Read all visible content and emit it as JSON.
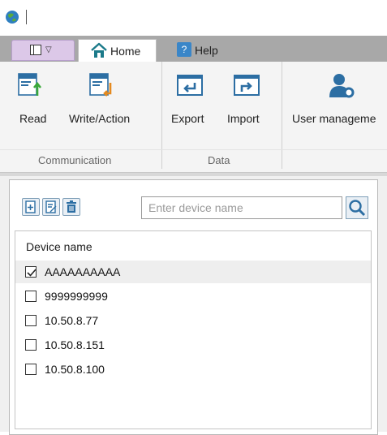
{
  "ribbon": {
    "tabs": [
      {
        "label": "Home",
        "active": true
      },
      {
        "label": "Help",
        "active": false
      }
    ],
    "groups": [
      {
        "label": "Communication",
        "buttons": [
          "Read",
          "Write/Action"
        ]
      },
      {
        "label": "Data",
        "buttons": [
          "Export",
          "Import"
        ]
      },
      {
        "label": "",
        "buttons": [
          "User manageme"
        ]
      }
    ]
  },
  "device_panel": {
    "search_placeholder": "Enter device name",
    "list_header": "Device name",
    "devices": [
      {
        "name": "AAAAAAAAAA",
        "checked": true
      },
      {
        "name": "9999999999",
        "checked": false
      },
      {
        "name": "10.50.8.77",
        "checked": false
      },
      {
        "name": "10.50.8.151",
        "checked": false
      },
      {
        "name": "10.50.8.100",
        "checked": false
      }
    ]
  },
  "icons": [
    "app-globe-icon",
    "panel-menu-icon",
    "home-icon",
    "help-icon",
    "read-icon",
    "write-action-icon",
    "export-icon",
    "import-icon",
    "user-management-icon",
    "add-device-icon",
    "edit-device-icon",
    "delete-device-icon",
    "search-icon"
  ],
  "colors": {
    "accent": "#3a86c8",
    "tab_bar": "#a8a8a8",
    "menu_button": "#dcc8e8"
  }
}
